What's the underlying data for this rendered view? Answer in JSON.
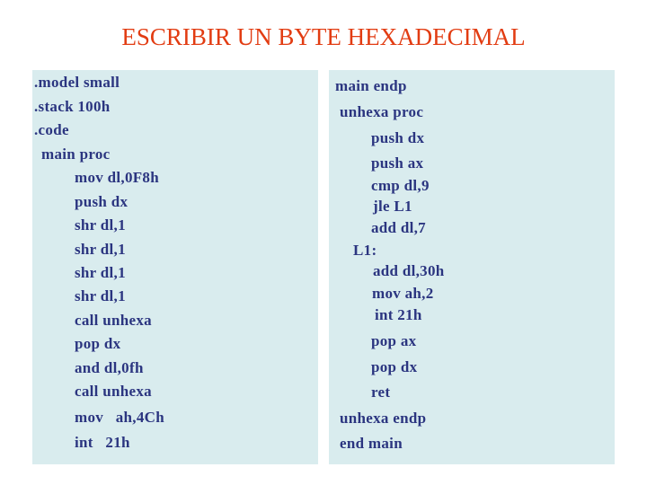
{
  "title": "ESCRIBIR UN BYTE HEXADECIMAL",
  "colors": {
    "title": "#e23c12",
    "code_text": "#2b3580",
    "panel_bg": "#d9ecee"
  },
  "left_panel": {
    "lines": [
      ".model small",
      ".stack 100h",
      ".code",
      "main proc",
      "mov dl,0F8h",
      "push dx",
      "shr dl,1",
      "shr dl,1",
      "shr dl,1",
      "shr dl,1",
      "call unhexa",
      "pop dx",
      "and dl,0fh",
      "call unhexa",
      "mov   ah,4Ch",
      "int   21h"
    ]
  },
  "right_panel": {
    "lines": [
      "main endp",
      "unhexa proc",
      "push dx",
      "push ax",
      "cmp dl,9",
      "jle L1",
      "add dl,7",
      "L1:",
      "add dl,30h",
      "mov ah,2",
      "int 21h",
      "pop ax",
      "pop dx",
      "ret",
      "unhexa endp",
      "end main"
    ]
  }
}
